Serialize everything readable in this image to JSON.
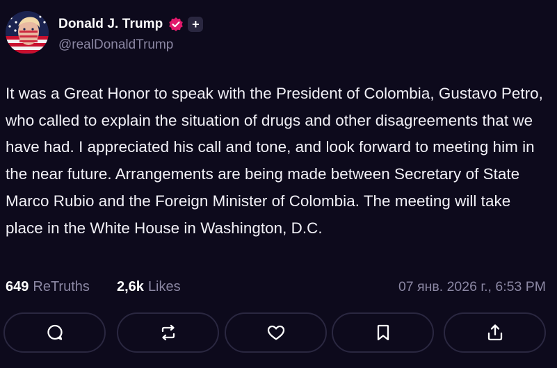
{
  "post": {
    "author": {
      "display_name": "Donald J. Trump",
      "handle": "@realDonaldTrump",
      "avatar_icon": "avatar-flag-portrait",
      "verified_icon": "verified-badge-icon",
      "plus_icon": "plus-icon"
    },
    "text": "It was a Great Honor to speak with the President of Colombia, Gustavo Petro, who called to explain the situation of drugs and other disagreements that we have had. I appreciated his call and tone, and look forward to meeting him in the near future. Arrangements are being made between Secretary of State Marco Rubio and the Foreign Minister of Colombia. The meeting will take place in the White House in Washington, D.C.",
    "stats": {
      "retruths_count": "649",
      "retruths_label": "ReTruths",
      "likes_count": "2,6k",
      "likes_label": "Likes"
    },
    "timestamp": "07 янв. 2026 г., 6:53 PM"
  },
  "actions": [
    {
      "name": "reply",
      "icon": "comment-icon"
    },
    {
      "name": "retruth",
      "icon": "retruth-icon"
    },
    {
      "name": "like",
      "icon": "heart-icon"
    },
    {
      "name": "bookmark",
      "icon": "bookmark-icon"
    },
    {
      "name": "share",
      "icon": "share-icon"
    }
  ],
  "colors": {
    "background": "#0d0a1c",
    "text": "#ffffff",
    "muted": "#8b87a3",
    "border": "#2a2740",
    "verified": "#e0196b"
  }
}
